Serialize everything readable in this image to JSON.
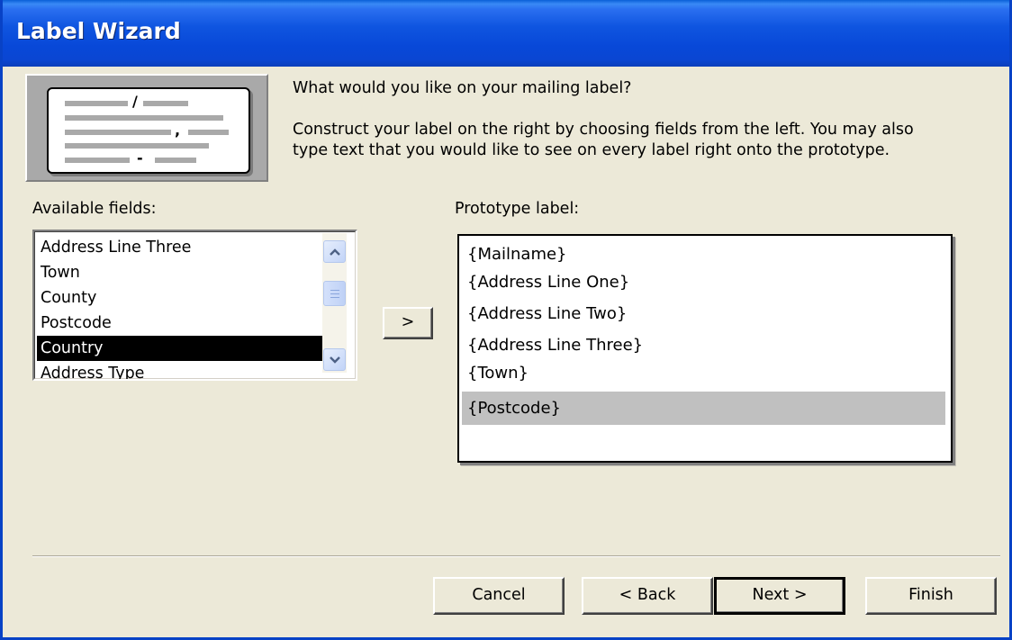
{
  "window": {
    "title": "Label Wizard"
  },
  "intro": {
    "question": "What would you like on your mailing label?",
    "line1": "Construct your label on the right by choosing fields from the left. You may also",
    "line2": "type text that you would like to see on every label right onto the prototype."
  },
  "illustration": {
    "marks": [
      "/",
      ",",
      "-"
    ]
  },
  "available": {
    "label": "Available fields:",
    "items": [
      "Address Line Three",
      "Town",
      "County",
      "Postcode",
      "Country",
      "Address Type"
    ],
    "selected": "Country"
  },
  "add_button": {
    "label": ">"
  },
  "prototype": {
    "label": "Prototype label:",
    "lines": [
      "{Mailname}",
      "{Address Line One}",
      "{Address Line Two}",
      "{Address Line Three}",
      "{Town}",
      "{Postcode}"
    ],
    "highlighted": "{Postcode}"
  },
  "buttons": {
    "cancel": "Cancel",
    "back": "< Back",
    "next": "Next >",
    "finish": "Finish"
  },
  "colors": {
    "title_bar": "#0a46d2",
    "dialog_bg": "#ece9d8",
    "selection": "#000000",
    "prototype_highlight": "#c0c0c0"
  }
}
